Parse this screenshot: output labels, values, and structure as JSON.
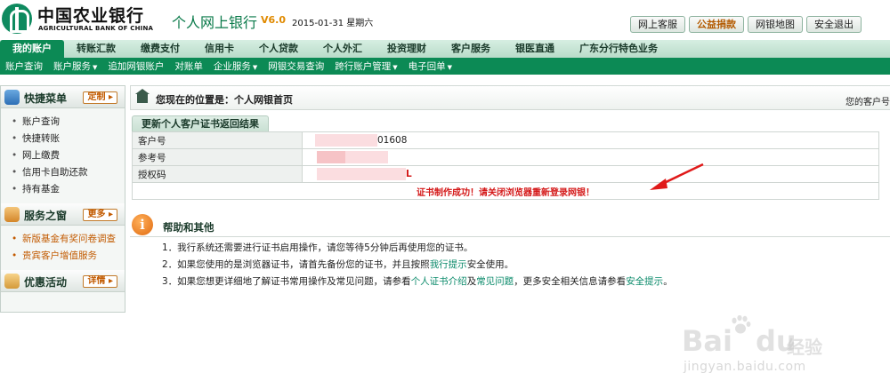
{
  "header": {
    "bank_name_cn": "中国农业银行",
    "bank_name_en": "AGRICULTURAL BANK OF CHINA",
    "product_title": "个人网上银行",
    "version": "V6.0",
    "date": "2015-01-31 星期六",
    "buttons": [
      "网上客服",
      "公益捐款",
      "网银地图",
      "安全退出"
    ]
  },
  "main_nav": {
    "items": [
      "我的账户",
      "转账汇款",
      "缴费支付",
      "信用卡",
      "个人贷款",
      "个人外汇",
      "投资理财",
      "客户服务",
      "银医直通",
      "广东分行特色业务"
    ],
    "active": "我的账户"
  },
  "sub_nav": {
    "items": [
      "账户查询",
      "账户服务",
      "追加网银账户",
      "对账单",
      "企业服务",
      "网银交易查询",
      "跨行账户管理",
      "电子回单"
    ],
    "with_dropdown": [
      "账户服务",
      "企业服务",
      "跨行账户管理",
      "电子回单"
    ]
  },
  "sidebar": {
    "quick_menu": {
      "title": "快捷菜单",
      "action": "定制",
      "items": [
        "账户查询",
        "快捷转账",
        "网上缴费",
        "信用卡自助还款",
        "持有基金"
      ]
    },
    "service_window": {
      "title": "服务之窗",
      "action": "更多",
      "items": [
        "新版基金有奖问卷调查",
        "贵宾客户增值服务"
      ]
    },
    "promotions": {
      "title": "优惠活动",
      "action": "详情"
    }
  },
  "content": {
    "location_label": "您现在的位置是：个人网银首页",
    "right_text": "您的客户号",
    "panel_title": "更新个人客户证书返回结果",
    "rows": [
      {
        "label": "客户号",
        "value": "01608"
      },
      {
        "label": "参考号",
        "value": ""
      },
      {
        "label": "授权码",
        "value": "L"
      }
    ],
    "message": "证书制作成功！请关闭浏览器重新登录网银！",
    "help": {
      "title": "帮助和其他",
      "icon_glyph": "i",
      "line1": "1．我行系统还需要进行证书启用操作，请您等待5分钟后再使用您的证书。",
      "line2_a": "2．如果您使用的是浏览器证书，请首先备份您的证书，并且按照",
      "line2_link": "我行提示",
      "line2_b": "安全使用。",
      "line3_a": "3．如果您想更详细地了解证书常用操作及常见问题，请参看",
      "line3_link1": "个人证书介绍",
      "line3_mid": "及",
      "line3_link2": "常见问题",
      "line3_b": "，更多安全相关信息请参看",
      "line3_link3": "安全提示",
      "line3_end": "。"
    }
  },
  "watermark": {
    "brand": "Bai",
    "brand_end": "du",
    "name": "经验",
    "url": "jingyan.baidu.com"
  },
  "colors": {
    "primary_green": "#0c8a55",
    "message_red": "#d41818",
    "link_green": "#0a8a6a"
  }
}
